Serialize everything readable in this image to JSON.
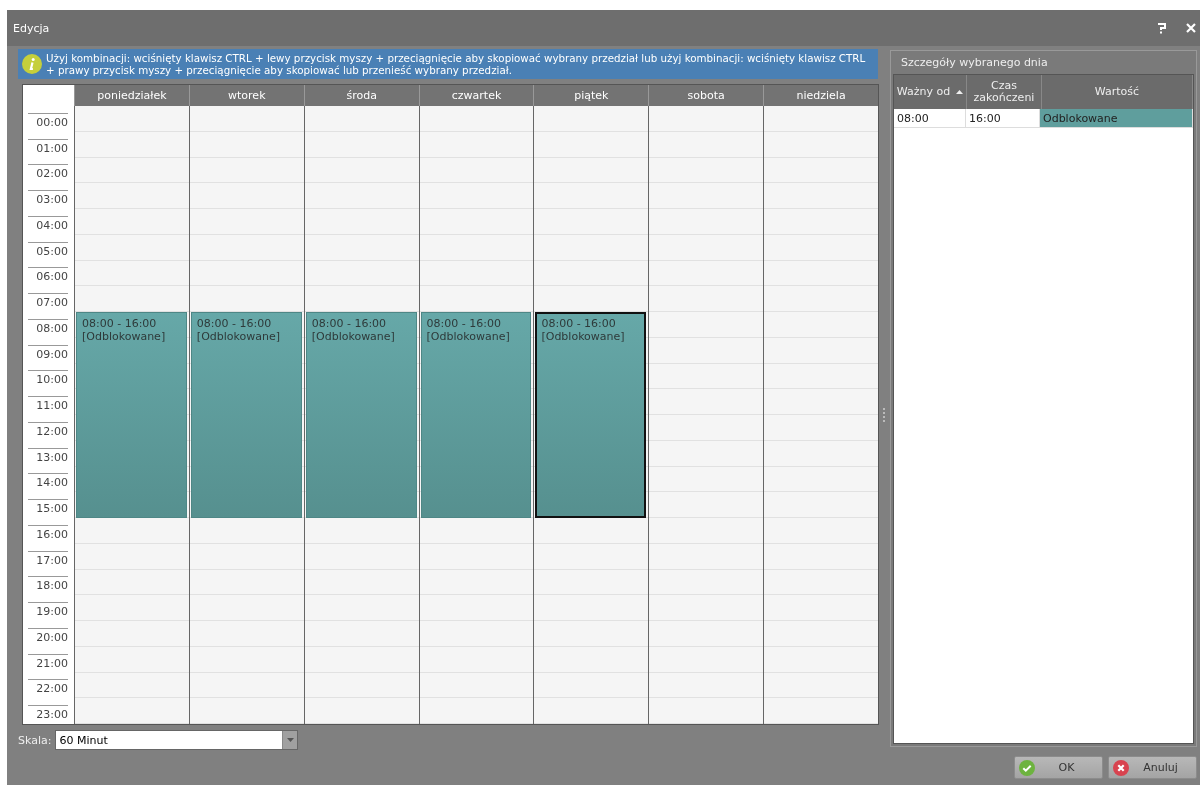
{
  "window": {
    "title": "Edycja"
  },
  "info": {
    "text": "Użyj kombinacji: wciśnięty klawisz CTRL + lewy przycisk myszy + przeciągnięcie aby skopiować wybrany przedział lub użyj kombinacji: wciśnięty klawisz CTRL + prawy przycisk myszy + przeciągnięcie aby skopiować lub przenieść wybrany przedział."
  },
  "hours": [
    "00:00",
    "01:00",
    "02:00",
    "03:00",
    "04:00",
    "05:00",
    "06:00",
    "07:00",
    "08:00",
    "09:00",
    "10:00",
    "11:00",
    "12:00",
    "13:00",
    "14:00",
    "15:00",
    "16:00",
    "17:00",
    "18:00",
    "19:00",
    "20:00",
    "21:00",
    "22:00",
    "23:00"
  ],
  "days": [
    {
      "label": "poniedziałek",
      "events": [
        {
          "time": "08:00 - 16:00",
          "value": "[Odblokowane]",
          "selected": false
        }
      ]
    },
    {
      "label": "wtorek",
      "events": [
        {
          "time": "08:00 - 16:00",
          "value": "[Odblokowane]",
          "selected": false
        }
      ]
    },
    {
      "label": "środa",
      "events": [
        {
          "time": "08:00 - 16:00",
          "value": "[Odblokowane]",
          "selected": false
        }
      ]
    },
    {
      "label": "czwartek",
      "events": [
        {
          "time": "08:00 - 16:00",
          "value": "[Odblokowane]",
          "selected": false
        }
      ]
    },
    {
      "label": "piątek",
      "events": [
        {
          "time": "08:00 - 16:00",
          "value": "[Odblokowane]",
          "selected": true
        }
      ]
    },
    {
      "label": "sobota"
    },
    {
      "label": "niedziela"
    }
  ],
  "scale": {
    "label": "Skala:",
    "value": "60 Minut"
  },
  "details": {
    "title": "Szczegóły wybranego dnia",
    "columns": [
      {
        "label": "Ważny od",
        "sorted": true
      },
      {
        "label": "Czas zakończeni",
        "sorted": false
      },
      {
        "label": "Wartość",
        "sorted": false
      }
    ],
    "rows": [
      {
        "cells": [
          {
            "text": "08:00",
            "focused": false
          },
          {
            "text": "16:00",
            "focused": false
          },
          {
            "text": "Odblokowane",
            "focused": true
          }
        ]
      }
    ]
  },
  "buttons": [
    {
      "label": "OK",
      "kind": "ok"
    },
    {
      "label": "Anuluj",
      "kind": "cancel"
    }
  ]
}
